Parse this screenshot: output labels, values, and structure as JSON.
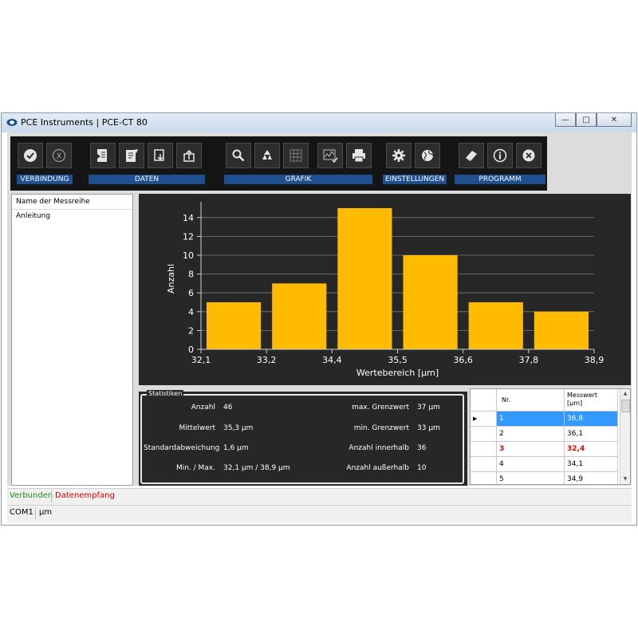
{
  "window": {
    "title": "PCE Instruments | PCE-CT 80",
    "minimize_glyph": "—",
    "maximize_glyph": "□",
    "close_glyph": "✕"
  },
  "toolbar": {
    "groups": [
      {
        "label": "VERBINDUNG"
      },
      {
        "label": "DATEN"
      },
      {
        "label": "GRAFIK"
      },
      {
        "label": "EINSTELLUNGEN"
      },
      {
        "label": "PROGRAMM"
      }
    ],
    "icons": {
      "connect": "check-icon",
      "disconnect": "x-circle-icon",
      "export": "export-icon",
      "edit": "edit-document-icon",
      "save": "save-icon",
      "open": "open-icon",
      "zoom": "magnifier-icon",
      "reset": "recycle-icon",
      "grid": "grid-icon",
      "graph_settings": "graph-check-icon",
      "print": "printer-icon",
      "settings": "gear-icon",
      "language": "globe-icon",
      "manual": "book-icon",
      "info": "info-icon",
      "exit": "close-icon"
    }
  },
  "list": {
    "header": "Name der Messreihe",
    "items": [
      "Anleitung"
    ]
  },
  "chart_data": {
    "type": "bar",
    "xlabel": "Wertebereich [µm]",
    "ylabel": "Anzahl",
    "x_ticks": [
      "32,1",
      "33,2",
      "34,4",
      "35,5",
      "36,6",
      "37,8",
      "38,9"
    ],
    "y_ticks": [
      "0",
      "2",
      "4",
      "6",
      "8",
      "10",
      "12",
      "14"
    ],
    "values": [
      5,
      7,
      15,
      10,
      5,
      4
    ],
    "ylim": [
      0,
      15
    ],
    "grid": true,
    "bar_color": "#ffbb00"
  },
  "stats": {
    "legend": "Statistiken",
    "left": [
      {
        "label": "Anzahl",
        "value": "46"
      },
      {
        "label": "Mittelwert",
        "value": "35,3 µm"
      },
      {
        "label": "Standardabweichung",
        "value": "1,6 µm"
      },
      {
        "label": "Min. / Max.",
        "value": "32,1 µm / 38,9 µm"
      }
    ],
    "right": [
      {
        "label": "max. Grenzwert",
        "value": "37 µm"
      },
      {
        "label": "min. Grenzwert",
        "value": "33 µm"
      },
      {
        "label": "Anzahl innerhalb",
        "value": "36"
      },
      {
        "label": "Anzahl außerhalb",
        "value": "10"
      }
    ]
  },
  "table": {
    "col_nr": "Nr.",
    "col_value": "Messwert",
    "col_unit": "[µm]",
    "rows": [
      {
        "nr": "1",
        "value": "36,8"
      },
      {
        "nr": "2",
        "value": "36,1"
      },
      {
        "nr": "3",
        "value": "32,4"
      },
      {
        "nr": "4",
        "value": "34,1"
      },
      {
        "nr": "5",
        "value": "34,9"
      }
    ],
    "selected_marker": "▶",
    "scroll_up": "▲",
    "scroll_down": "▼"
  },
  "status": {
    "connected": "Verbunden",
    "receiving": "Datenempfang",
    "port": "COM1",
    "unit": "µm",
    "connected_color": "#1e8c1e",
    "receiving_color": "#e00000"
  }
}
